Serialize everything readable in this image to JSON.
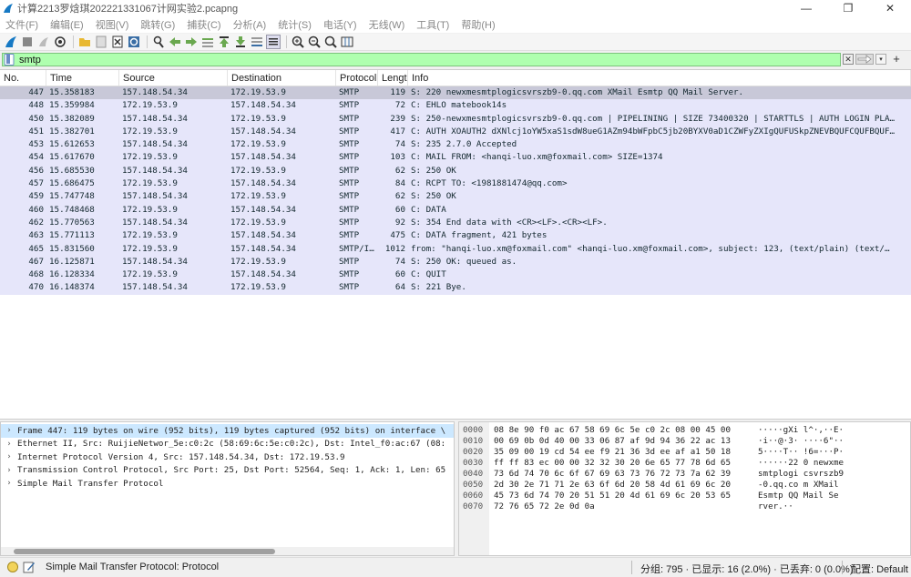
{
  "window": {
    "title": "计算2213罗焓琪202221331067计网实验2.pcapng",
    "minimize": "—",
    "maximize": "❐",
    "close": "✕"
  },
  "menu": [
    "文件(F)",
    "编辑(E)",
    "视图(V)",
    "跳转(G)",
    "捕获(C)",
    "分析(A)",
    "统计(S)",
    "电话(Y)",
    "无线(W)",
    "工具(T)",
    "帮助(H)"
  ],
  "filter": {
    "value": "smtp",
    "clear": "✕",
    "dropdown": "▾",
    "add": "+"
  },
  "packet_list": {
    "columns": [
      "No.",
      "Time",
      "Source",
      "Destination",
      "Protocol",
      "Lengtl",
      "Info"
    ],
    "rows": [
      {
        "no": "447",
        "time": "15.358183",
        "src": "157.148.54.34",
        "dst": "172.19.53.9",
        "proto": "SMTP",
        "len": "119",
        "info": "S: 220 newxmesmtplogicsvrszb9-0.qq.com XMail Esmtp QQ Mail Server."
      },
      {
        "no": "448",
        "time": "15.359984",
        "src": "172.19.53.9",
        "dst": "157.148.54.34",
        "proto": "SMTP",
        "len": "72",
        "info": "C: EHLO matebook14s"
      },
      {
        "no": "450",
        "time": "15.382089",
        "src": "157.148.54.34",
        "dst": "172.19.53.9",
        "proto": "SMTP",
        "len": "239",
        "info": "S: 250-newxmesmtplogicsvrszb9-0.qq.com | PIPELINING | SIZE 73400320 | STARTTLS | AUTH LOGIN PLA…"
      },
      {
        "no": "451",
        "time": "15.382701",
        "src": "172.19.53.9",
        "dst": "157.148.54.34",
        "proto": "SMTP",
        "len": "417",
        "info": "C: AUTH XOAUTH2 dXNlcj1oYW5xaS1sdW8ueG1AZm94bWFpbC5jb20BYXV0aD1CZWFyZXIgQUFUSkpZNEVBQUFCQUFBQUF…"
      },
      {
        "no": "453",
        "time": "15.612653",
        "src": "157.148.54.34",
        "dst": "172.19.53.9",
        "proto": "SMTP",
        "len": "74",
        "info": "S: 235 2.7.0 Accepted"
      },
      {
        "no": "454",
        "time": "15.617670",
        "src": "172.19.53.9",
        "dst": "157.148.54.34",
        "proto": "SMTP",
        "len": "103",
        "info": "C: MAIL FROM: <hanqi-luo.xm@foxmail.com> SIZE=1374"
      },
      {
        "no": "456",
        "time": "15.685530",
        "src": "157.148.54.34",
        "dst": "172.19.53.9",
        "proto": "SMTP",
        "len": "62",
        "info": "S: 250 OK"
      },
      {
        "no": "457",
        "time": "15.686475",
        "src": "172.19.53.9",
        "dst": "157.148.54.34",
        "proto": "SMTP",
        "len": "84",
        "info": "C: RCPT TO: <1981881474@qq.com>"
      },
      {
        "no": "459",
        "time": "15.747748",
        "src": "157.148.54.34",
        "dst": "172.19.53.9",
        "proto": "SMTP",
        "len": "62",
        "info": "S: 250 OK"
      },
      {
        "no": "460",
        "time": "15.748468",
        "src": "172.19.53.9",
        "dst": "157.148.54.34",
        "proto": "SMTP",
        "len": "60",
        "info": "C: DATA"
      },
      {
        "no": "462",
        "time": "15.770563",
        "src": "157.148.54.34",
        "dst": "172.19.53.9",
        "proto": "SMTP",
        "len": "92",
        "info": "S: 354 End data with <CR><LF>.<CR><LF>."
      },
      {
        "no": "463",
        "time": "15.771113",
        "src": "172.19.53.9",
        "dst": "157.148.54.34",
        "proto": "SMTP",
        "len": "475",
        "info": "C: DATA fragment, 421 bytes"
      },
      {
        "no": "465",
        "time": "15.831560",
        "src": "172.19.53.9",
        "dst": "157.148.54.34",
        "proto": "SMTP/I…",
        "len": "1012",
        "info": "from: \"hanqi-luo.xm@foxmail.com\" <hanqi-luo.xm@foxmail.com>, subject: 123,  (text/plain) (text/…"
      },
      {
        "no": "467",
        "time": "16.125871",
        "src": "157.148.54.34",
        "dst": "172.19.53.9",
        "proto": "SMTP",
        "len": "74",
        "info": "S: 250 OK: queued as."
      },
      {
        "no": "468",
        "time": "16.128334",
        "src": "172.19.53.9",
        "dst": "157.148.54.34",
        "proto": "SMTP",
        "len": "60",
        "info": "C: QUIT"
      },
      {
        "no": "470",
        "time": "16.148374",
        "src": "157.148.54.34",
        "dst": "172.19.53.9",
        "proto": "SMTP",
        "len": "64",
        "info": "S: 221 Bye."
      }
    ]
  },
  "details": [
    "Frame 447: 119 bytes on wire (952 bits), 119 bytes captured (952 bits) on interface \\",
    "Ethernet II, Src: RuijieNetwor_5e:c0:2c (58:69:6c:5e:c0:2c), Dst: Intel_f0:ac:67 (08:",
    "Internet Protocol Version 4, Src: 157.148.54.34, Dst: 172.19.53.9",
    "Transmission Control Protocol, Src Port: 25, Dst Port: 52564, Seq: 1, Ack: 1, Len: 65",
    "Simple Mail Transfer Protocol"
  ],
  "bytes": [
    {
      "off": "0000",
      "hex": "08 8e 90 f0 ac 67 58 69  6c 5e c0 2c 08 00 45 00",
      "asc": "·····gXi l^·,··E·"
    },
    {
      "off": "0010",
      "hex": "00 69 0b 0d 40 00 33 06  87 af 9d 94 36 22 ac 13",
      "asc": "·i··@·3· ····6\"··"
    },
    {
      "off": "0020",
      "hex": "35 09 00 19 cd 54 ee f9  21 36 3d ee af a1 50 18",
      "asc": "5····T·· !6=···P·"
    },
    {
      "off": "0030",
      "hex": "ff ff 83 ec 00 00 32 32  30 20 6e 65 77 78 6d 65",
      "asc": "······22 0 newxme"
    },
    {
      "off": "0040",
      "hex": "73 6d 74 70 6c 6f 67 69  63 73 76 72 73 7a 62 39",
      "asc": "smtplogi csvrszb9"
    },
    {
      "off": "0050",
      "hex": "2d 30 2e 71 71 2e 63 6f  6d 20 58 4d 61 69 6c 20",
      "asc": "-0.qq.co m XMail "
    },
    {
      "off": "0060",
      "hex": "45 73 6d 74 70 20 51 51  20 4d 61 69 6c 20 53 65",
      "asc": "Esmtp QQ  Mail Se"
    },
    {
      "off": "0070",
      "hex": "72 76 65 72 2e 0d 0a",
      "asc": "rver.··"
    }
  ],
  "status": {
    "text": "Simple Mail Transfer Protocol: Protocol",
    "packets": "分组: 795 · 已显示: 16 (2.0%) · 已丢弃: 0 (0.0%)",
    "profile": "配置: Default"
  },
  "colors": {
    "filter_valid": "#afffaf",
    "smtp_row": "#e6e6fa",
    "selected_row": "#c8c8d8"
  }
}
